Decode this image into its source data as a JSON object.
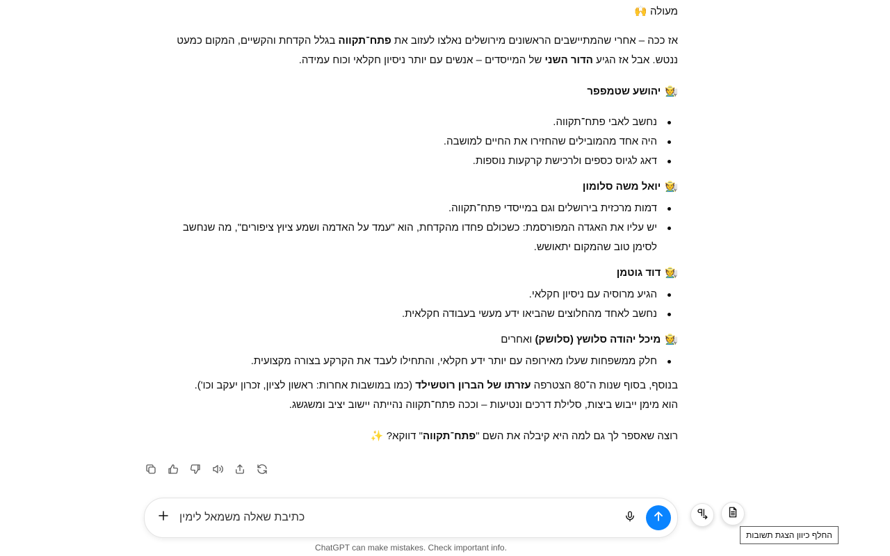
{
  "message": {
    "top_line": "מעולה",
    "top_emoji": "🙌",
    "intro_parts": [
      "אז ככה – אחרי שהמתיישבים הראשונים מירושלים נאלצו לעזוב את ",
      "פתח־תקווה",
      " בגלל הקדחת והקשיים, המקום כמעט ננטש. אבל אז הגיע ",
      "הדור השני",
      " של המייסדים – אנשים עם יותר ניסיון חקלאי וכוח עמידה."
    ],
    "person_emoji": "🧑‍🌾",
    "people": [
      {
        "name": "יהושע שטמפפר",
        "suffix": "",
        "bullets": [
          "נחשב לאבי פתח־תקווה.",
          "היה אחד מהמובילים שהחזירו את החיים למושבה.",
          "דאג לגיוס כספים ולרכישת קרקעות נוספות."
        ]
      },
      {
        "name": "יואל משה סלומון",
        "suffix": "",
        "bullets": [
          "דמות מרכזית בירושלים וגם במייסדי פתח־תקווה.",
          "יש עליו את האגדה המפורסמת: כשכולם פחדו מהקדחת, הוא \"עמד על האדמה ושמע ציוץ ציפורים\", מה שנחשב לסימן טוב שהמקום יתאושש."
        ]
      },
      {
        "name": "דוד גוטמן",
        "suffix": "",
        "bullets": [
          "הגיע מרוסיה עם ניסיון חקלאי.",
          "נחשב לאחד מהחלוצים שהביאו ידע מעשי בעבודה חקלאית."
        ]
      },
      {
        "name": "מיכל יהודה סלושץ (סלושק)",
        "suffix": " ואחרים",
        "bullets": [
          "חלק ממשפחות שעלו מאירופה עם יותר ידע חקלאי, והתחילו לעבד את הקרקע בצורה מקצועית."
        ]
      }
    ],
    "closing_parts": [
      "בנוסף, בסוף שנות ה־80 הצטרפה ",
      "עזרתו של הברון רוטשילד",
      " (כמו במושבות אחרות: ראשון לציון, זכרון יעקב וכו').",
      "הוא מימן ייבוש ביצות, סלילת דרכים ונטיעות – וככה פתח־תקווה נהייתה יישוב יציב ומשגשג."
    ],
    "question_parts": [
      "רוצה שאספר לך גם למה היא קיבלה את השם \"",
      "פתח־תקווה",
      "\" דווקא?"
    ],
    "question_emoji": "✨"
  },
  "actions": [
    "copy-icon",
    "thumbs-up-icon",
    "thumbs-down-icon",
    "read-aloud-icon",
    "share-icon",
    "regenerate-icon"
  ],
  "composer": {
    "placeholder": "כתיבת שאלה משמאל לימין",
    "send_color": "#0a84ff"
  },
  "tooltip": "החלף כיוון הצגת תשובות",
  "footer": "ChatGPT can make mistakes. Check important info."
}
